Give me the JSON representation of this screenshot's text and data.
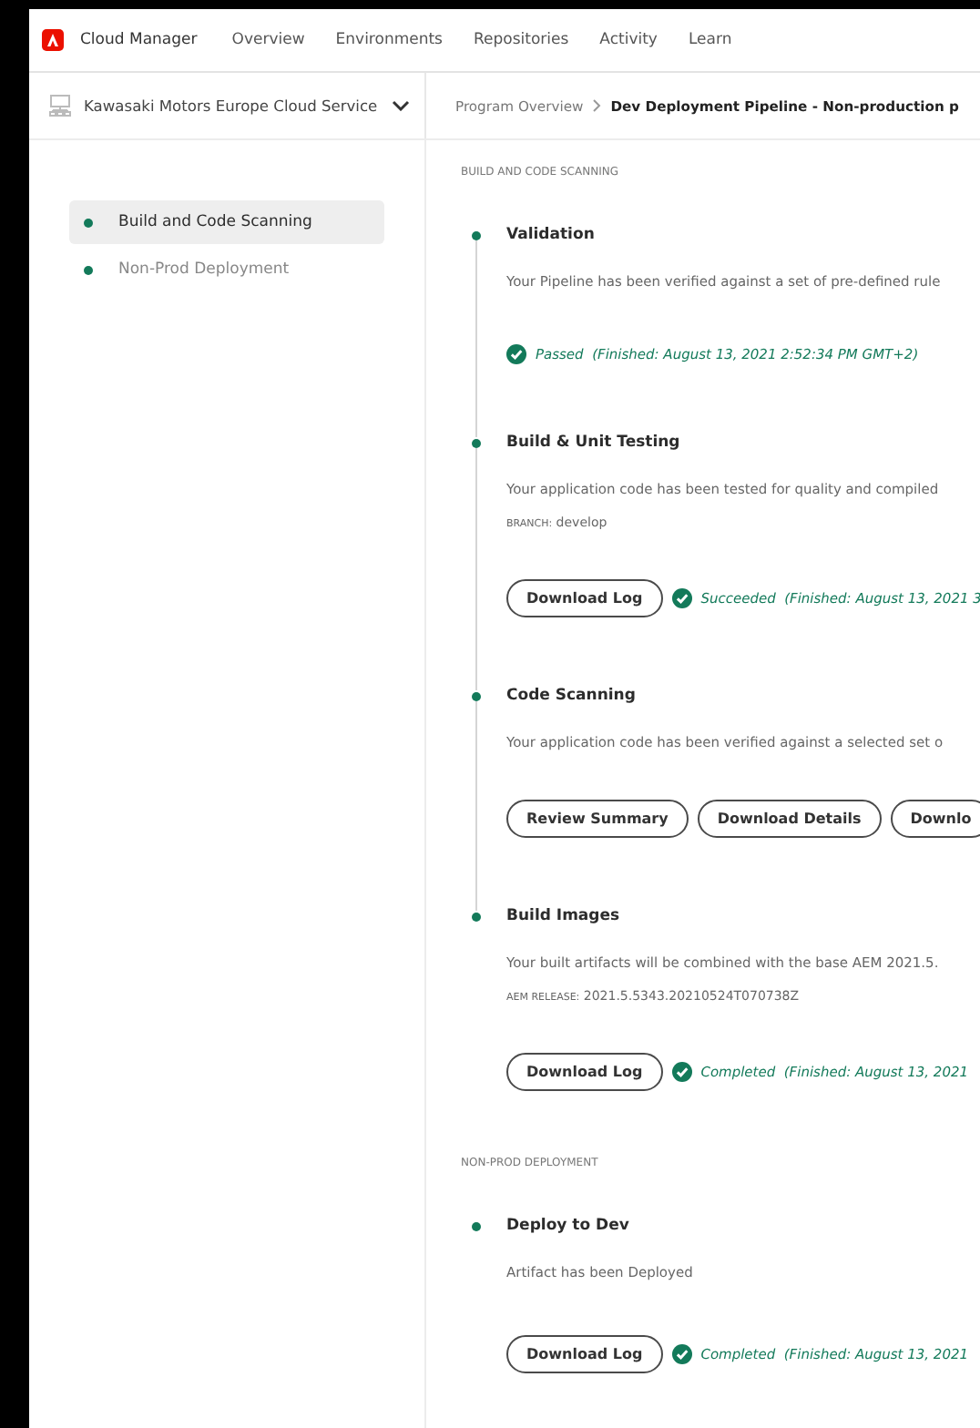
{
  "app": {
    "title": "Cloud Manager"
  },
  "nav": [
    {
      "label": "Overview"
    },
    {
      "label": "Environments"
    },
    {
      "label": "Repositories"
    },
    {
      "label": "Activity"
    },
    {
      "label": "Learn"
    }
  ],
  "program": {
    "name": "Kawasaki Motors Europe Cloud Service"
  },
  "breadcrumb": [
    {
      "label": "Program Overview",
      "current": false
    },
    {
      "label": "Dev Deployment Pipeline - Non-production p",
      "current": true
    }
  ],
  "sidebar": {
    "items": [
      {
        "label": "Build and Code Scanning",
        "selected": true,
        "color": "#137a5a"
      },
      {
        "label": "Non-Prod Deployment",
        "selected": false,
        "color": "#137a5a"
      }
    ]
  },
  "sections": [
    {
      "label": "BUILD AND CODE SCANNING",
      "steps": [
        {
          "title": "Validation",
          "description": "Your Pipeline has been verified against a set of pre-defined rule",
          "status": "Passed",
          "finished": "(Finished: August 13, 2021 2:52:34 PM GMT+2)"
        },
        {
          "title": "Build & Unit Testing",
          "description": "Your application code has been tested for quality and compiled",
          "meta_label": "BRANCH:",
          "meta_value": "develop",
          "buttons": [
            "Download Log"
          ],
          "status": "Succeeded",
          "finished": "(Finished: August 13, 2021 3"
        },
        {
          "title": "Code Scanning",
          "description": "Your application code has been verified against a selected set o",
          "buttons": [
            "Review Summary",
            "Download Details",
            "Downlo"
          ]
        },
        {
          "title": "Build Images",
          "description": "Your built artifacts will be combined with the base AEM 2021.5.",
          "meta_label": "AEM RELEASE:",
          "meta_value": "2021.5.5343.20210524T070738Z",
          "buttons": [
            "Download Log"
          ],
          "status": "Completed",
          "finished": "(Finished: August 13, 2021"
        }
      ]
    },
    {
      "label": "NON-PROD DEPLOYMENT",
      "steps": [
        {
          "title": "Deploy to Dev",
          "description": "Artifact has been Deployed",
          "buttons": [
            "Download Log"
          ],
          "status": "Completed",
          "finished": "(Finished: August 13, 2021"
        }
      ]
    }
  ]
}
